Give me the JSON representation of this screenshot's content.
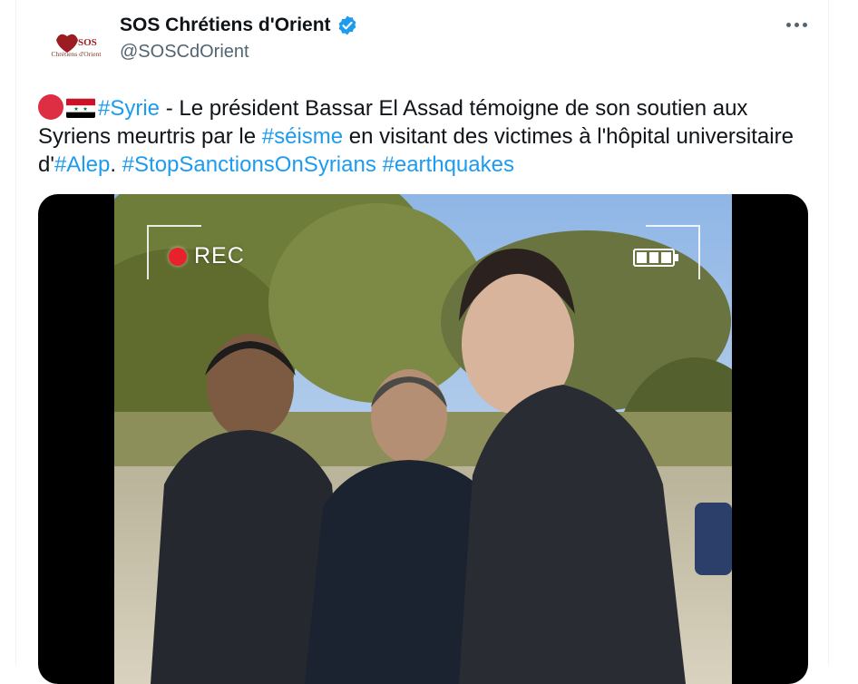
{
  "account": {
    "display_name": "SOS Chrétiens d'Orient",
    "handle": "@SOSCdOrient",
    "avatar_text_top": "SOS",
    "avatar_text_bottom": "Chrétiens d'Orient",
    "verified_color": "#1d9bf0"
  },
  "tweet": {
    "segments": [
      {
        "type": "emoji",
        "name": "red-circle-emoji"
      },
      {
        "type": "emoji",
        "name": "syria-flag-emoji"
      },
      {
        "type": "tag",
        "text": "#Syrie"
      },
      {
        "type": "text",
        "text": " - Le président Bassar El Assad témoigne de son soutien aux Syriens meurtris par le "
      },
      {
        "type": "tag",
        "text": "#séisme"
      },
      {
        "type": "text",
        "text": " en visitant des victimes à l'hôpital universitaire d'"
      },
      {
        "type": "tag",
        "text": "#Alep"
      },
      {
        "type": "text",
        "text": ". "
      },
      {
        "type": "tag",
        "text": "#StopSanctionsOnSyrians"
      },
      {
        "type": "text",
        "text": " "
      },
      {
        "type": "tag",
        "text": "#earthquakes"
      }
    ]
  },
  "media": {
    "rec_label": "REC",
    "battery_bars": 3
  },
  "colors": {
    "link": "#1d9bf0",
    "text": "#0f1419",
    "secondary": "#536471"
  }
}
